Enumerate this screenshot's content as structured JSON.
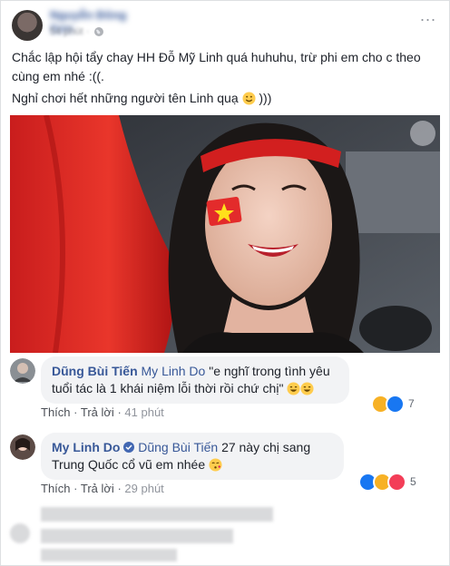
{
  "post": {
    "author_name": "Nguyễn Đông Sơn",
    "time": "54 phút",
    "more": "...",
    "text_line1": "Chắc lập hội tẩy chay HH Đỗ Mỹ Linh quá huhuhu, trừ phi em cho c theo cùng em nhé :((.",
    "text_line2": "Nghỉ chơi hết những người tên Linh quạ",
    "text_line2_tail": ")))"
  },
  "comments": [
    {
      "author": "Dũng Bùi Tiến",
      "tag": "My Linh Do",
      "text": "\"e nghĩ trong tình yêu tuổi tác là 1 khái niệm lỗi thời rồi chứ chị\"",
      "like": "Thích",
      "reply": "Trả lời",
      "time": "41 phút",
      "reaction_count": "7"
    },
    {
      "author": "My Linh Do",
      "tag": "Dũng Bùi Tiến",
      "text": "27 này chị sang Trung Quốc cổ vũ em nhée",
      "like": "Thích",
      "reply": "Trả lời",
      "time": "29 phút",
      "reaction_count": "5"
    }
  ],
  "separator": "·",
  "colors": {
    "link": "#385898",
    "bubble": "#f2f3f5",
    "flag_red": "#e32b2b",
    "star_yellow": "#ffe01b"
  }
}
